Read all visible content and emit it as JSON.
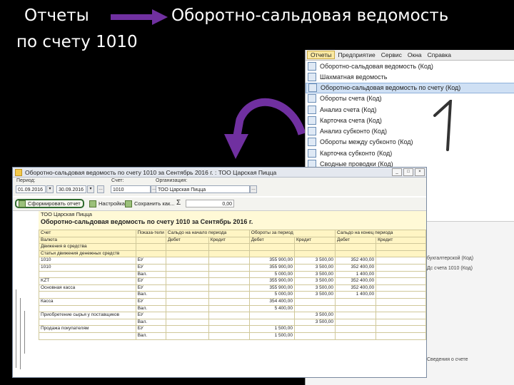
{
  "slide": {
    "title_left": "Отчеты",
    "title_right": "Оборотно-сальдовая ведомость",
    "title_second_line": "по счету 1010"
  },
  "colors": {
    "arrow": "#7030a0",
    "highlight": "#cfe0f4",
    "report_header": "#fff5c4"
  },
  "menu": {
    "tabs": [
      "Отчеты",
      "Предприятие",
      "Сервис",
      "Окна",
      "Справка"
    ],
    "items": [
      {
        "label": "Оборотно-сальдовая ведомость (Код)",
        "icon": "report-icon"
      },
      {
        "label": "Шахматная ведомость",
        "icon": "report-icon"
      },
      {
        "label": "Оборотно-сальдовая ведомость по счету (Код)",
        "icon": "report-icon",
        "selected": true
      },
      {
        "label": "Обороты счета (Код)",
        "icon": "report-icon"
      },
      {
        "label": "Анализ счета (Код)",
        "icon": "report-icon"
      },
      {
        "label": "Карточка счета (Код)",
        "icon": "report-icon"
      },
      {
        "label": "Анализ субконто (Код)",
        "icon": "report-icon"
      },
      {
        "label": "Обороты между субконто (Код)",
        "icon": "report-icon"
      },
      {
        "label": "Карточка субконто (Код)",
        "icon": "report-icon"
      },
      {
        "label": "Сводные проводки (Код)",
        "icon": "report-icon"
      }
    ],
    "side_text_1": "бухгалтерской (Код)",
    "side_text_2": "Дс счета 1010 (Код)",
    "side_text_3": "Сведения о счете"
  },
  "annotation_number": "1",
  "report": {
    "window_title": "Оборотно-сальдовая ведомость по счету 1010 за Сентябрь 2016 г. : ТОО Царская Пицца",
    "params": {
      "period_label": "Период:",
      "period_from": "01.09.2016",
      "period_to": "30.09.2016",
      "account_label": "Счет:",
      "account_value": "1010",
      "org_label": "Организация:",
      "org_value": "ТОО Царская Пицца"
    },
    "toolbar": {
      "generate_label": "Сформировать отчет",
      "settings_label": "Настройка...",
      "save_label": "Сохранить как...",
      "sum_symbol": "Σ",
      "sum_value": "0,00"
    },
    "org_name": "ТОО Царская Пицца",
    "heading": "Оборотно-сальдовая ведомость по счету 1010 за Сентябрь 2016 г.",
    "columns": {
      "account": "Счет",
      "indicator": "Показа-тели",
      "opening": "Сальдо на начало периода",
      "turnover": "Обороты за период",
      "closing": "Сальдо на конец периода",
      "debit": "Дебет",
      "credit": "Кредит"
    },
    "row_labels": [
      "Валюта",
      "Движения в средства",
      "Статьи движения денежных средств"
    ],
    "rows": [
      {
        "account": "1010",
        "ind": "БУ",
        "od": "",
        "oc": "",
        "td": "355 900,00",
        "tc": "3 500,00",
        "cd": "352 400,00",
        "cc": ""
      },
      {
        "account": "1010",
        "ind": "БУ",
        "od": "",
        "oc": "",
        "td": "355 900,00",
        "tc": "3 500,00",
        "cd": "352 400,00",
        "cc": ""
      },
      {
        "account": "",
        "ind": "Вал.",
        "od": "",
        "oc": "",
        "td": "5 000,00",
        "tc": "3 500,00",
        "cd": "1 400,00",
        "cc": ""
      },
      {
        "account": "KZT",
        "ind": "БУ",
        "od": "",
        "oc": "",
        "td": "355 900,00",
        "tc": "3 500,00",
        "cd": "352 400,00",
        "cc": ""
      },
      {
        "account": "Основная касса",
        "ind": "БУ",
        "od": "",
        "oc": "",
        "td": "355 900,00",
        "tc": "3 500,00",
        "cd": "352 400,00",
        "cc": ""
      },
      {
        "account": "",
        "ind": "Вал.",
        "od": "",
        "oc": "",
        "td": "5 000,00",
        "tc": "3 500,00",
        "cd": "1 400,00",
        "cc": ""
      },
      {
        "account": "Касса",
        "ind": "БУ",
        "od": "",
        "oc": "",
        "td": "354 400,00",
        "tc": "",
        "cd": "",
        "cc": ""
      },
      {
        "account": "",
        "ind": "Вал.",
        "od": "",
        "oc": "",
        "td": "5 400,00",
        "tc": "",
        "cd": "",
        "cc": ""
      },
      {
        "account": "Приобретение сырья у поставщиков",
        "ind": "БУ",
        "od": "",
        "oc": "",
        "td": "",
        "tc": "3 500,00",
        "cd": "",
        "cc": ""
      },
      {
        "account": "",
        "ind": "Вал.",
        "od": "",
        "oc": "",
        "td": "",
        "tc": "3 500,00",
        "cd": "",
        "cc": ""
      },
      {
        "account": "Продажа покупателям",
        "ind": "БУ",
        "od": "",
        "oc": "",
        "td": "1 500,00",
        "tc": "",
        "cd": "",
        "cc": ""
      },
      {
        "account": "",
        "ind": "Вал.",
        "od": "",
        "oc": "",
        "td": "1 500,00",
        "tc": "",
        "cd": "",
        "cc": ""
      }
    ]
  }
}
